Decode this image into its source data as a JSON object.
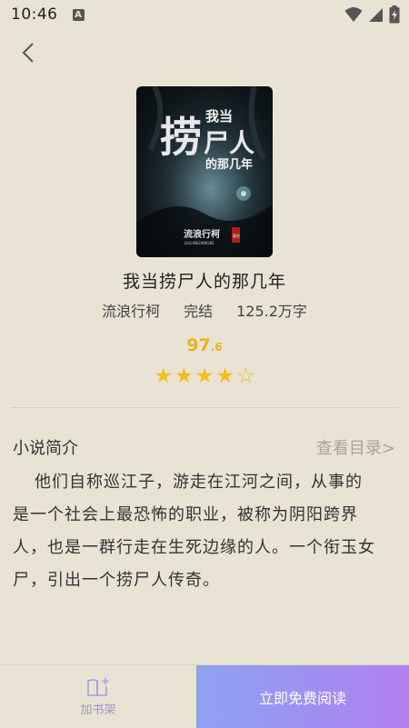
{
  "status": {
    "time": "10:46",
    "indicator": "A"
  },
  "book": {
    "title": "我当捞尸人的那几年",
    "author": "流浪行柯",
    "status": "完结",
    "word_count": "125.2万字",
    "score_int": "97",
    "score_dec": ".6",
    "rating": 4,
    "rating_max": 5
  },
  "cover": {
    "title_big": "捞",
    "title_small": "我当",
    "title_mid": "尸人",
    "title_sub": "的那几年",
    "author": "流浪行柯",
    "author_pinyin": "LIULANGXINGKE",
    "seal": "著作"
  },
  "intro": {
    "heading": "小说简介",
    "toc_link": "查看目录>",
    "text": "他们自称巡江子，游走在江河之间，从事的是一个社会上最恐怖的职业，被称为阴阳跨界人，也是一群行走在生死边缘的人。一个衔玉女尸，引出一个捞尸人传奇。"
  },
  "bottom": {
    "shelf_label": "加书架",
    "read_label": "立即免费阅读"
  },
  "colors": {
    "background": "#e9e3d4",
    "score": "#e8b31c",
    "star": "#f0bd22",
    "accent_gradient_start": "#8ea3f2",
    "accent_gradient_end": "#b37ff0"
  },
  "icons": {
    "back": "chevron-left-icon",
    "shelf": "bookshelf-add-icon",
    "wifi": "wifi-icon",
    "signal": "signal-icon",
    "battery": "battery-icon"
  }
}
